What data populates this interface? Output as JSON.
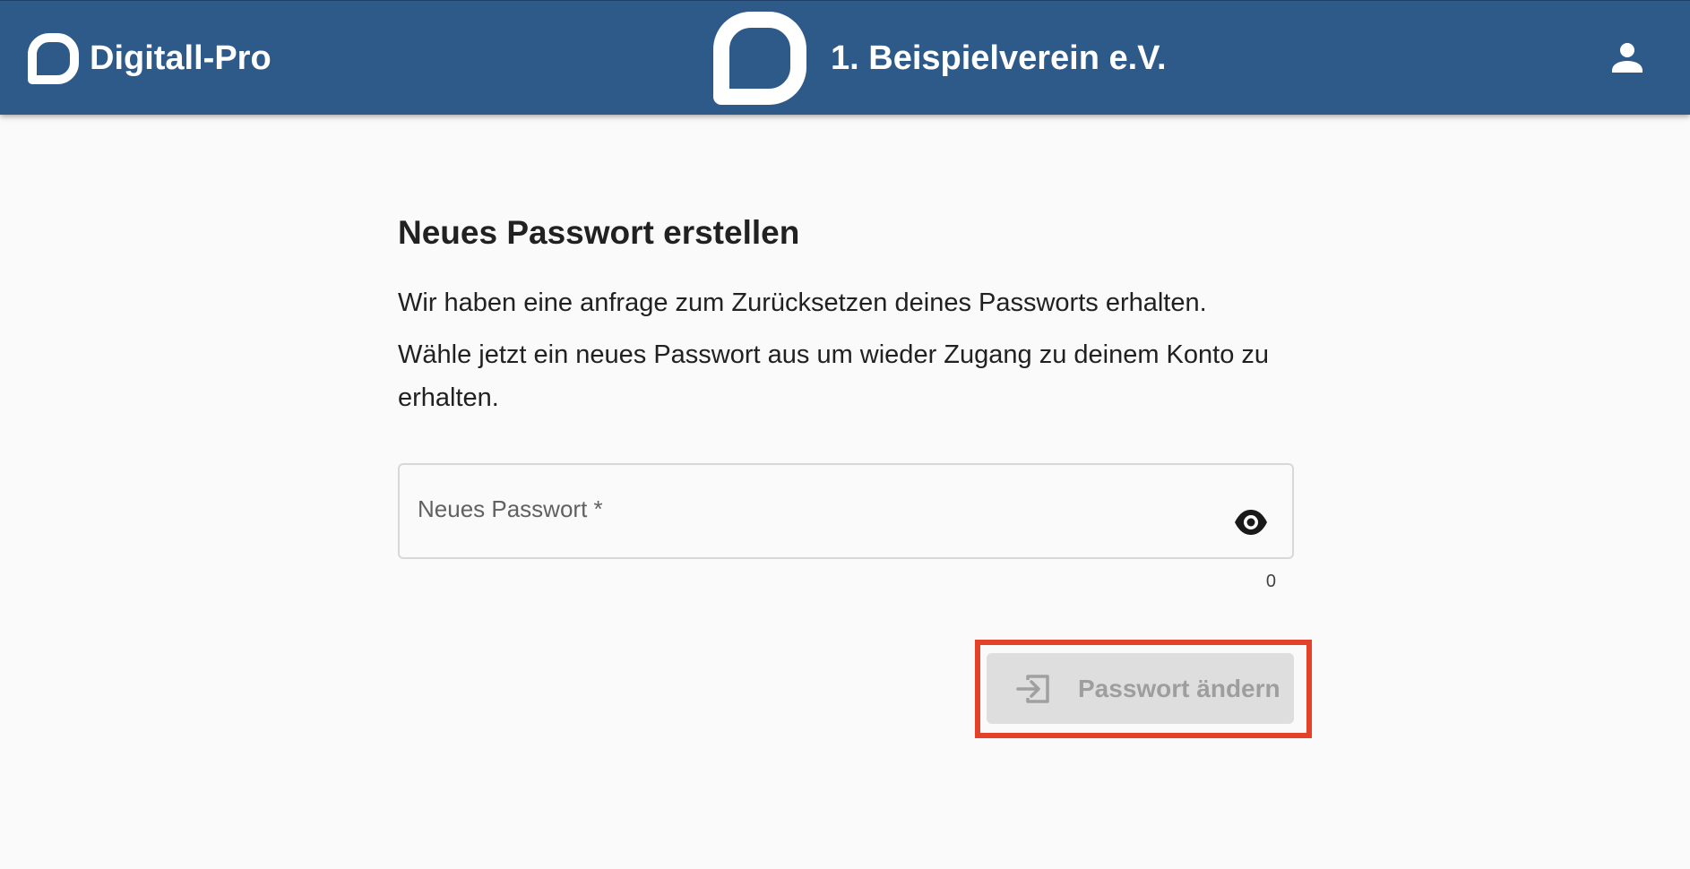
{
  "header": {
    "brand_name": "Digitall-Pro",
    "club_name": "1. Beispielverein e.V.",
    "background_color": "#2e5a8a",
    "brand_icon": "speech-bubble-logo-icon",
    "account_icon": "person-icon"
  },
  "form": {
    "title": "Neues Passwort erstellen",
    "paragraph_1": "Wir haben eine anfrage zum Zurücksetzen deines Passworts erhalten.",
    "paragraph_2_line_1": "Wähle jetzt ein neues Passwort aus um wieder Zugang zu deinem Konto zu",
    "paragraph_2_line_2": "erhalten.",
    "password_field": {
      "label": "Neues Passwort *",
      "value": "",
      "character_count": "0",
      "toggle_icon": "eye-icon"
    },
    "submit": {
      "label": "Passwort ändern",
      "icon": "login-arrow-icon",
      "state": "disabled"
    }
  },
  "annotation": {
    "highlight_color": "#e4412a"
  }
}
